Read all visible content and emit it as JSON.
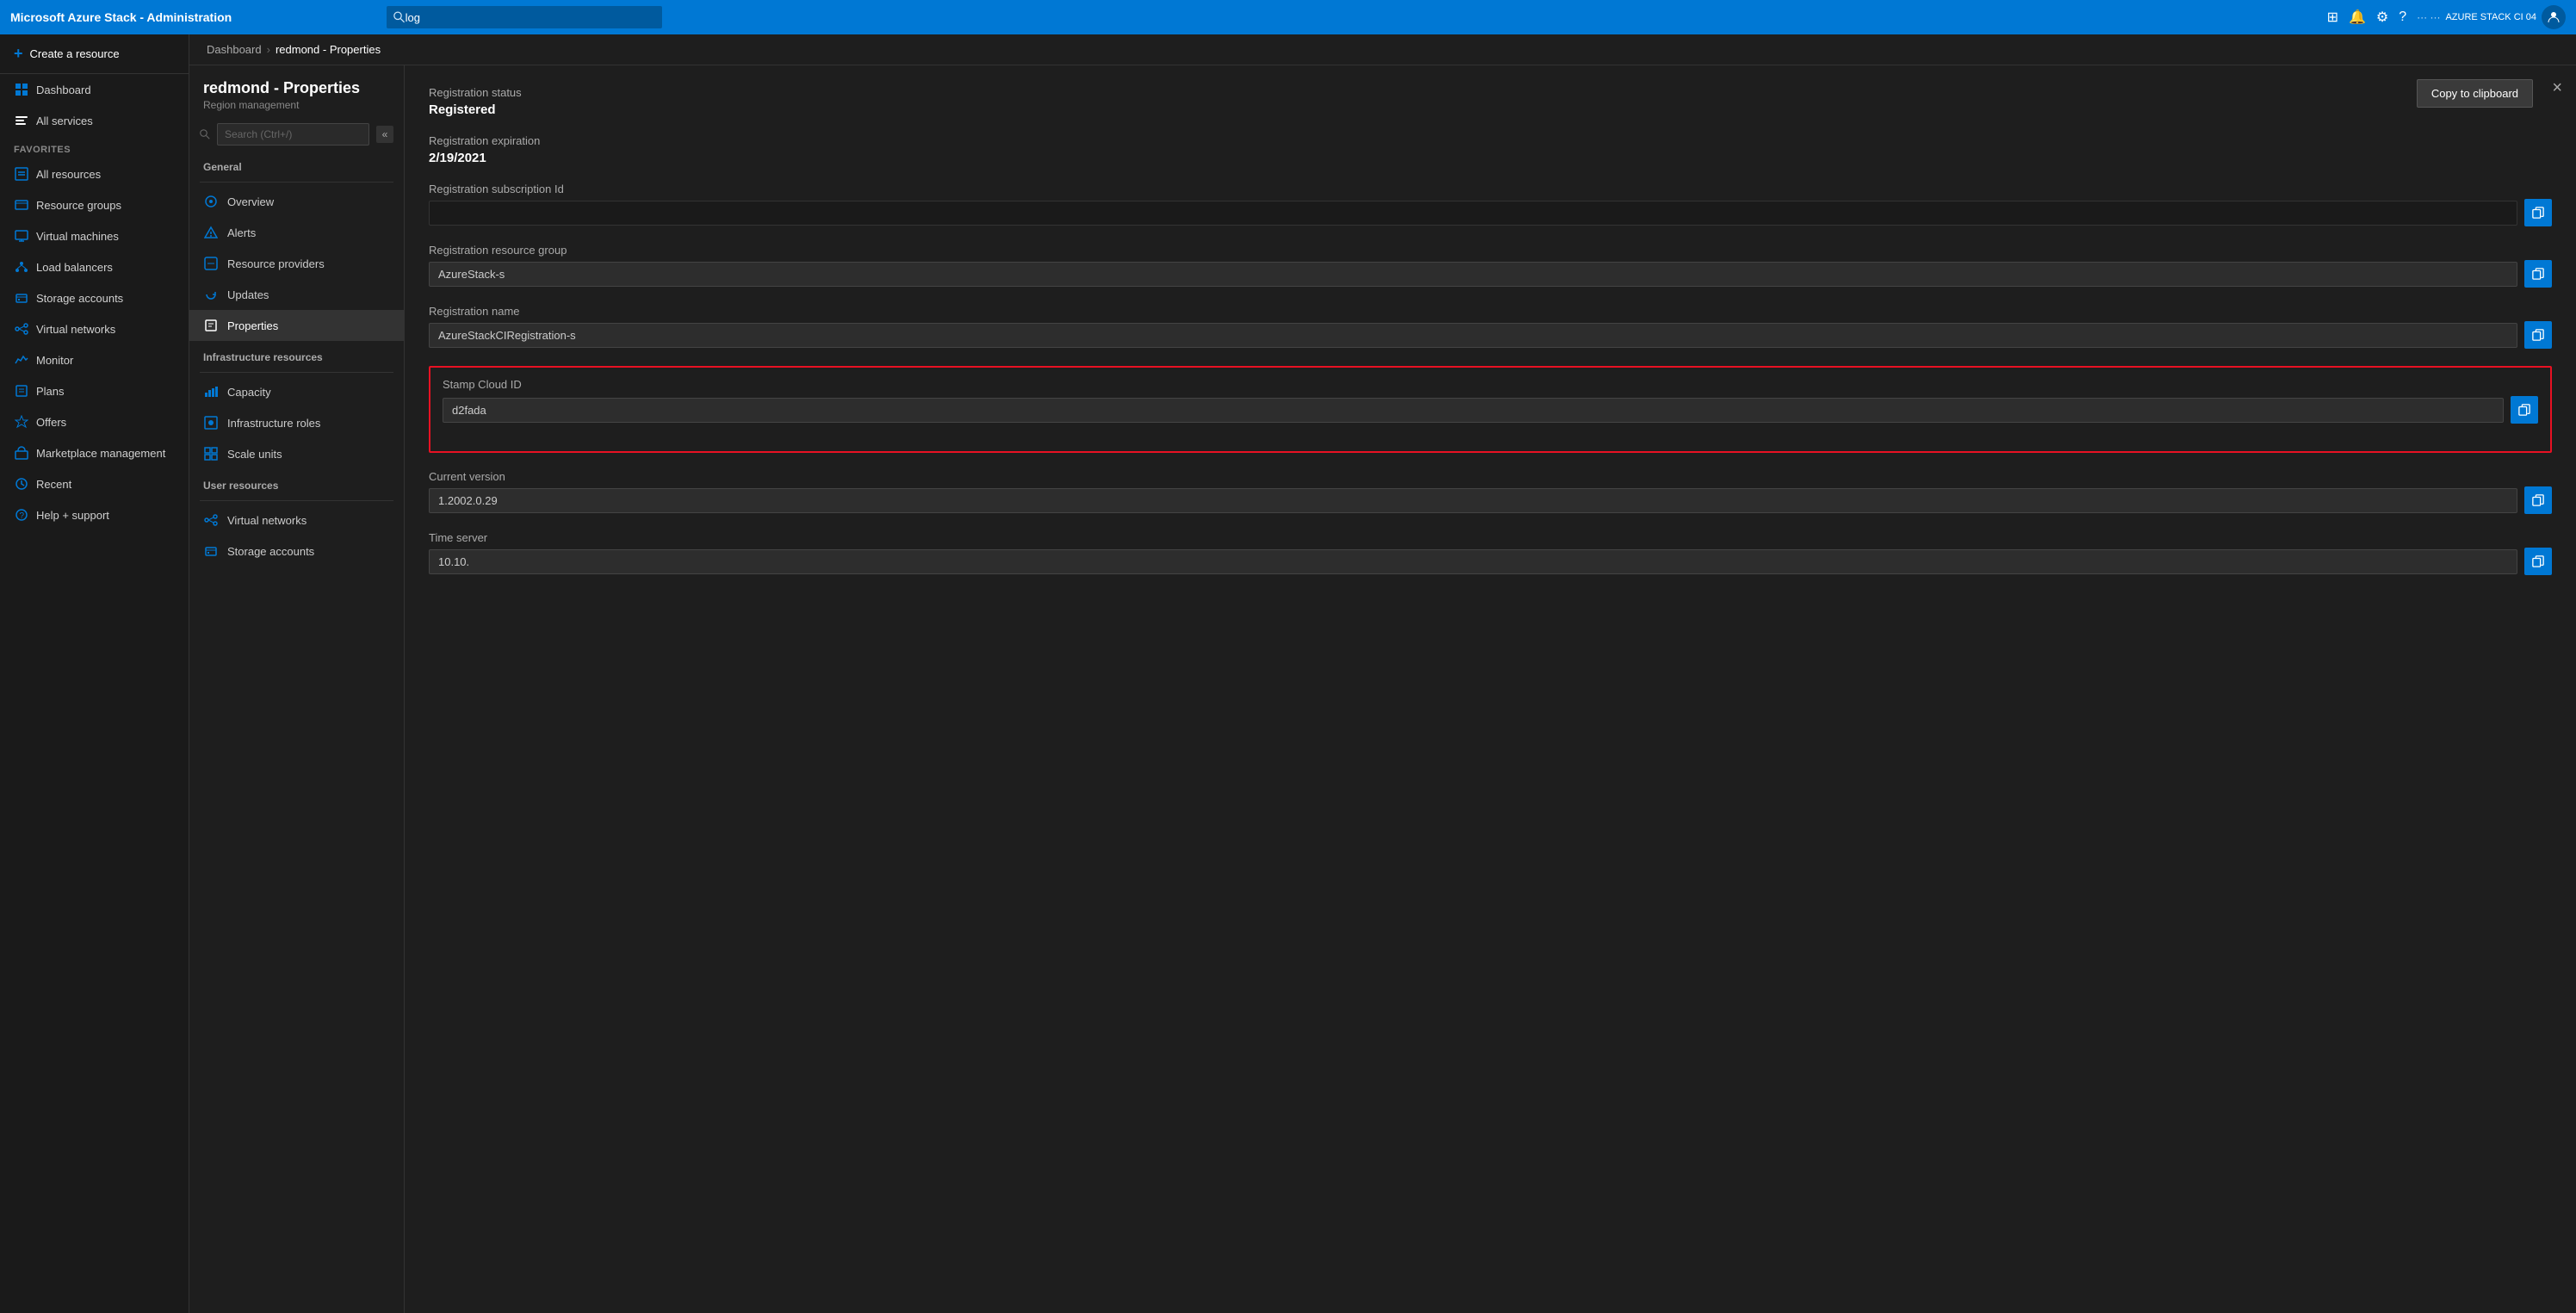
{
  "topbar": {
    "title": "Microsoft Azure Stack - Administration",
    "search_placeholder": "log",
    "user_label": "AZURE STACK CI 04",
    "icons": [
      "portal-icon",
      "bell-icon",
      "settings-icon",
      "help-icon"
    ]
  },
  "sidebar": {
    "create_label": "Create a resource",
    "items": [
      {
        "id": "dashboard",
        "label": "Dashboard",
        "icon": "dashboard-icon"
      },
      {
        "id": "all-services",
        "label": "All services",
        "icon": "all-services-icon"
      }
    ],
    "favorites_label": "FAVORITES",
    "favorites": [
      {
        "id": "all-resources",
        "label": "All resources",
        "icon": "all-resources-icon"
      },
      {
        "id": "resource-groups",
        "label": "Resource groups",
        "icon": "resource-groups-icon"
      },
      {
        "id": "virtual-machines",
        "label": "Virtual machines",
        "icon": "virtual-machines-icon"
      },
      {
        "id": "load-balancers",
        "label": "Load balancers",
        "icon": "load-balancers-icon"
      },
      {
        "id": "storage-accounts",
        "label": "Storage accounts",
        "icon": "storage-accounts-icon"
      },
      {
        "id": "virtual-networks",
        "label": "Virtual networks",
        "icon": "virtual-networks-icon"
      },
      {
        "id": "monitor",
        "label": "Monitor",
        "icon": "monitor-icon"
      },
      {
        "id": "plans",
        "label": "Plans",
        "icon": "plans-icon"
      },
      {
        "id": "offers",
        "label": "Offers",
        "icon": "offers-icon"
      },
      {
        "id": "marketplace-management",
        "label": "Marketplace management",
        "icon": "marketplace-icon"
      },
      {
        "id": "recent",
        "label": "Recent",
        "icon": "recent-icon"
      },
      {
        "id": "help-support",
        "label": "Help + support",
        "icon": "help-support-icon"
      }
    ]
  },
  "breadcrumb": {
    "items": [
      "Dashboard",
      "redmond - Properties"
    ],
    "separator": "›"
  },
  "nav_panel": {
    "title": "redmond - Properties",
    "subtitle": "Region management",
    "search_placeholder": "Search (Ctrl+/)",
    "sections": [
      {
        "label": "General",
        "items": [
          {
            "id": "overview",
            "label": "Overview",
            "icon": "overview-icon"
          },
          {
            "id": "alerts",
            "label": "Alerts",
            "icon": "alerts-icon"
          },
          {
            "id": "resource-providers",
            "label": "Resource providers",
            "icon": "resource-providers-icon"
          },
          {
            "id": "updates",
            "label": "Updates",
            "icon": "updates-icon"
          },
          {
            "id": "properties",
            "label": "Properties",
            "icon": "properties-icon",
            "active": true
          }
        ]
      },
      {
        "label": "Infrastructure resources",
        "items": [
          {
            "id": "capacity",
            "label": "Capacity",
            "icon": "capacity-icon"
          },
          {
            "id": "infrastructure-roles",
            "label": "Infrastructure roles",
            "icon": "infra-roles-icon"
          },
          {
            "id": "scale-units",
            "label": "Scale units",
            "icon": "scale-units-icon"
          }
        ]
      },
      {
        "label": "User resources",
        "items": [
          {
            "id": "virtual-networks-nav",
            "label": "Virtual networks",
            "icon": "virtual-networks-icon"
          },
          {
            "id": "storage-accounts-nav",
            "label": "Storage accounts",
            "icon": "storage-accounts-icon"
          }
        ]
      }
    ]
  },
  "properties_panel": {
    "close_label": "×",
    "clipboard_toast": "Copy to clipboard",
    "fields": [
      {
        "id": "registration-status",
        "label": "Registration status",
        "value": "Registered",
        "type": "text-large",
        "copyable": false
      },
      {
        "id": "registration-expiration",
        "label": "Registration expiration",
        "value": "2/19/2021",
        "type": "text-large",
        "copyable": false
      },
      {
        "id": "registration-subscription-id",
        "label": "Registration subscription Id",
        "value": "",
        "type": "redacted",
        "copyable": true
      },
      {
        "id": "registration-resource-group",
        "label": "Registration resource group",
        "value": "AzureStack-s",
        "type": "field",
        "copyable": true
      },
      {
        "id": "registration-name",
        "label": "Registration name",
        "value": "AzureStackCIRegistration-s",
        "type": "field",
        "copyable": true
      },
      {
        "id": "stamp-cloud-id",
        "label": "Stamp Cloud ID",
        "value": "d2fada",
        "type": "field-highlighted",
        "copyable": true
      },
      {
        "id": "current-version",
        "label": "Current version",
        "value": "1.2002.0.29",
        "type": "field",
        "copyable": true
      },
      {
        "id": "time-server",
        "label": "Time server",
        "value": "10.10.",
        "type": "field",
        "copyable": true
      }
    ]
  }
}
